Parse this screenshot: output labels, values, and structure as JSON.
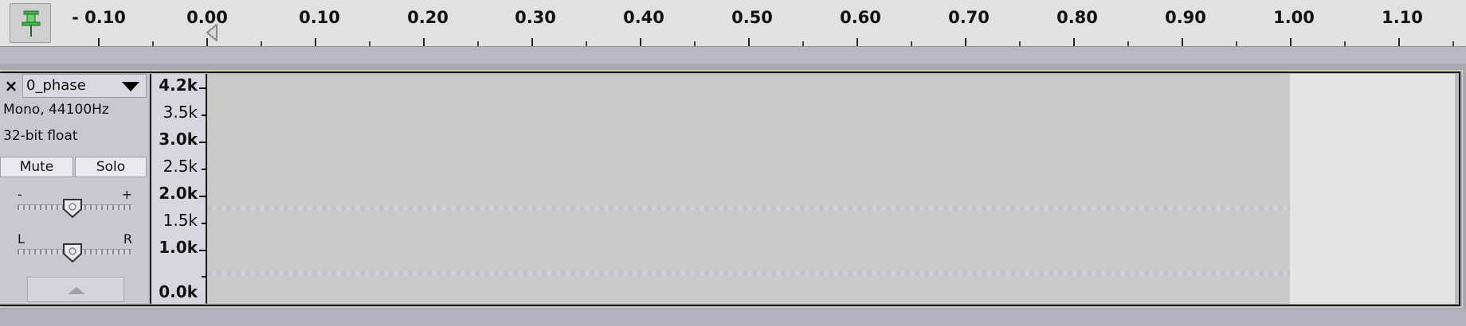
{
  "ruler": {
    "pin_icon": "pin-icon",
    "ticks": [
      "- 0.10",
      "0.00",
      "0.10",
      "0.20",
      "0.30",
      "0.40",
      "0.50",
      "0.60",
      "0.70",
      "0.80",
      "0.90",
      "1.00",
      "1.10"
    ]
  },
  "track": {
    "close_label": "×",
    "name": "0_phase",
    "format": "Mono, 44100Hz",
    "bit_depth": "32-bit float",
    "mute_label": "Mute",
    "solo_label": "Solo",
    "gain_minus": "-",
    "gain_plus": "+",
    "pan_left": "L",
    "pan_right": "R",
    "collapse_icon": "collapse-arrow-icon"
  },
  "frequency_scale": {
    "labels": [
      "4.2k",
      "3.5k",
      "3.0k",
      "2.5k",
      "2.0k",
      "1.5k",
      "1.0k",
      "0.0k"
    ]
  },
  "colors": {
    "background": "#a9a9b6",
    "ruler": "#e1e1e1",
    "spectrogram": "#c9c9c9",
    "panel": "#c8c8d2",
    "pin_green": "#3fb24a"
  }
}
